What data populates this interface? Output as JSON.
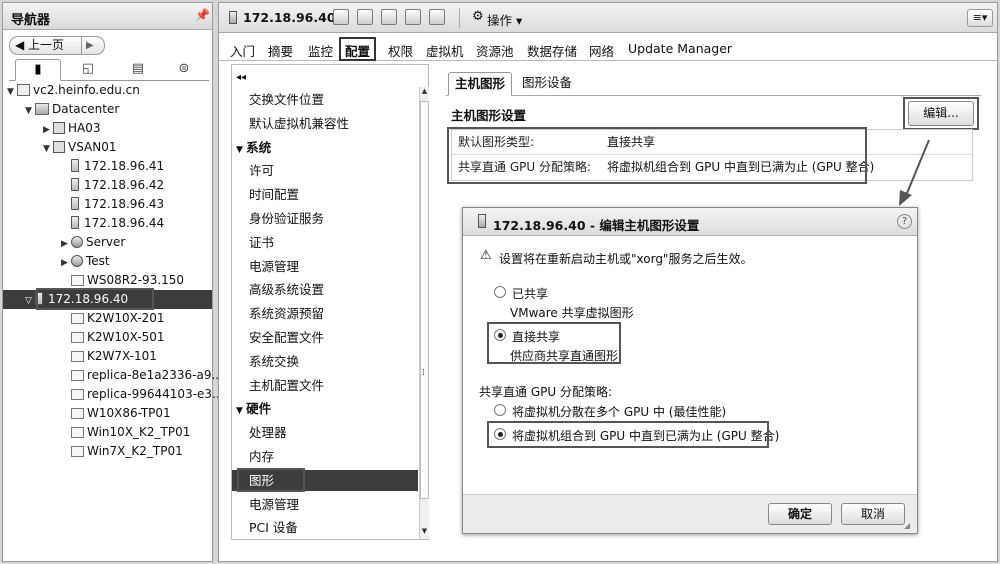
{
  "navigator": {
    "title": "导航器",
    "back_label": "◀ 上一页",
    "tree": [
      {
        "label": "vc2.heinfo.edu.cn",
        "icon": "vcenter-icon",
        "indent": 0,
        "arrow": "▼"
      },
      {
        "label": "Datacenter",
        "icon": "datacenter-icon",
        "indent": 1,
        "arrow": "▼"
      },
      {
        "label": "HA03",
        "icon": "cluster-icon",
        "indent": 2,
        "arrow": "▶"
      },
      {
        "label": "VSAN01",
        "icon": "cluster-icon",
        "indent": 2,
        "arrow": "▼"
      },
      {
        "label": "172.18.96.41",
        "icon": "host-icon",
        "indent": 3,
        "arrow": ""
      },
      {
        "label": "172.18.96.42",
        "icon": "host-icon",
        "indent": 3,
        "arrow": ""
      },
      {
        "label": "172.18.96.43",
        "icon": "host-icon",
        "indent": 3,
        "arrow": ""
      },
      {
        "label": "172.18.96.44",
        "icon": "host-icon",
        "indent": 3,
        "arrow": ""
      },
      {
        "label": "Server",
        "icon": "resource-pool-icon",
        "indent": 3,
        "arrow": "▶"
      },
      {
        "label": "Test",
        "icon": "resource-pool-icon",
        "indent": 3,
        "arrow": "▶"
      },
      {
        "label": "WS08R2-93.150",
        "icon": "vm-icon",
        "indent": 3,
        "arrow": ""
      },
      {
        "label": "172.18.96.40",
        "icon": "host-icon",
        "indent": 1,
        "arrow": "▽",
        "selected": true
      },
      {
        "label": "K2W10X-201",
        "icon": "vm-icon",
        "indent": 3,
        "arrow": ""
      },
      {
        "label": "K2W10X-501",
        "icon": "vm-icon",
        "indent": 3,
        "arrow": ""
      },
      {
        "label": "K2W7X-101",
        "icon": "vm-icon",
        "indent": 3,
        "arrow": ""
      },
      {
        "label": "replica-8e1a2336-a9...",
        "icon": "vm-icon",
        "indent": 3,
        "arrow": ""
      },
      {
        "label": "replica-99644103-e3...",
        "icon": "vm-icon",
        "indent": 3,
        "arrow": ""
      },
      {
        "label": "W10X86-TP01",
        "icon": "vm-icon",
        "indent": 3,
        "arrow": ""
      },
      {
        "label": "Win10X_K2_TP01",
        "icon": "vm-icon",
        "indent": 3,
        "arrow": ""
      },
      {
        "label": "Win7X_K2_TP01",
        "icon": "vm-icon",
        "indent": 3,
        "arrow": ""
      }
    ]
  },
  "toolbar": {
    "host": "172.18.96.40",
    "actions_label": "操作 ▾"
  },
  "tabs": [
    "入门",
    "摘要",
    "监控",
    "配置",
    "权限",
    "虚拟机",
    "资源池",
    "数据存储",
    "网络",
    "Update Manager"
  ],
  "settings_list": [
    {
      "label": "交换文件位置",
      "type": "item"
    },
    {
      "label": "默认虚拟机兼容性",
      "type": "item"
    },
    {
      "label": "系统",
      "type": "section"
    },
    {
      "label": "许可",
      "type": "item"
    },
    {
      "label": "时间配置",
      "type": "item"
    },
    {
      "label": "身份验证服务",
      "type": "item"
    },
    {
      "label": "证书",
      "type": "item"
    },
    {
      "label": "电源管理",
      "type": "item"
    },
    {
      "label": "高级系统设置",
      "type": "item"
    },
    {
      "label": "系统资源预留",
      "type": "item"
    },
    {
      "label": "安全配置文件",
      "type": "item"
    },
    {
      "label": "系统交换",
      "type": "item"
    },
    {
      "label": "主机配置文件",
      "type": "item"
    },
    {
      "label": "硬件",
      "type": "section"
    },
    {
      "label": "处理器",
      "type": "item"
    },
    {
      "label": "内存",
      "type": "item"
    },
    {
      "label": "图形",
      "type": "item",
      "selected": true
    },
    {
      "label": "电源管理",
      "type": "item"
    },
    {
      "label": "PCI 设备",
      "type": "item"
    }
  ],
  "content": {
    "tabs": [
      "主机图形",
      "图形设备"
    ],
    "section_title": "主机图形设置",
    "edit_button": "编辑...",
    "properties": [
      {
        "key": "默认图形类型:",
        "value": "直接共享"
      },
      {
        "key": "共享直通 GPU 分配策略:",
        "value": "将虚拟机组合到 GPU 中直到已满为止 (GPU 整合)"
      }
    ]
  },
  "dialog": {
    "title": "172.18.96.40 - 编辑主机图形设置",
    "warning": "设置将在重新启动主机或\"xorg\"服务之后生效。",
    "option1_label": "已共享",
    "option1_desc": "VMware 共享虚拟图形",
    "option2_label": "直接共享",
    "option2_desc": "供应商共享直通图形",
    "policy_title": "共享直通 GPU 分配策略:",
    "policy1": "将虚拟机分散在多个 GPU 中 (最佳性能)",
    "policy2": "将虚拟机组合到 GPU 中直到已满为止 (GPU 整合)",
    "ok": "确定",
    "cancel": "取消"
  }
}
